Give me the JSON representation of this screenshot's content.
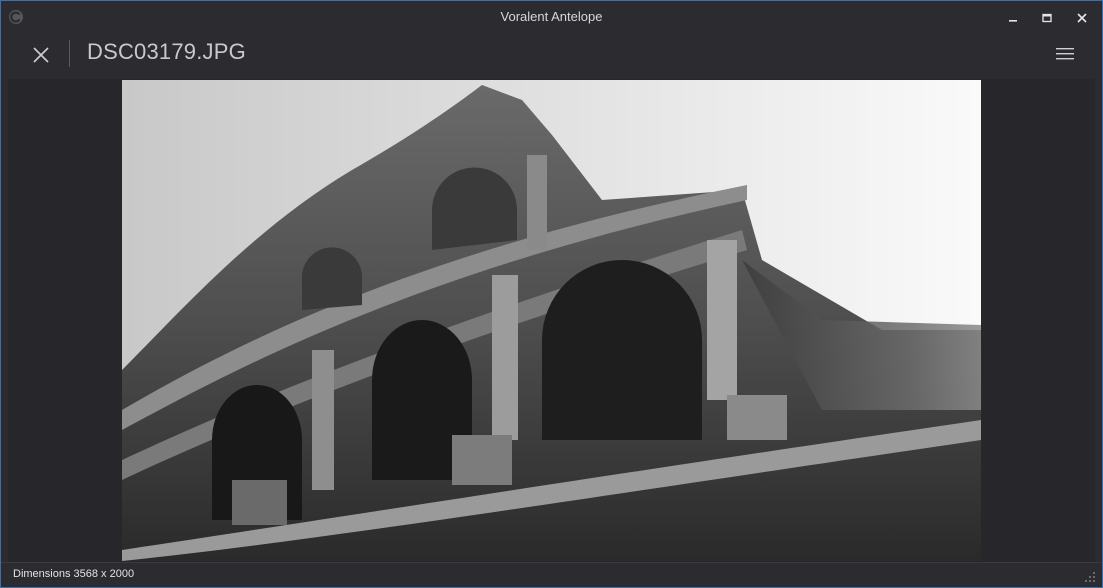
{
  "window": {
    "title": "Voralent Antelope",
    "icon": "app-logo-icon"
  },
  "toolbar": {
    "filename": "DSC03179.JPG",
    "close_icon": "close-icon",
    "menu_icon": "hamburger-menu-icon"
  },
  "viewer": {
    "image_subject": "black-and-white photo of Colosseum exterior"
  },
  "status": {
    "dimensions": "Dimensions 3568 x 2000"
  },
  "colors": {
    "window_border": "#3a6fb0",
    "chrome_bg": "#2b2b30",
    "viewer_bg": "#26262b"
  }
}
